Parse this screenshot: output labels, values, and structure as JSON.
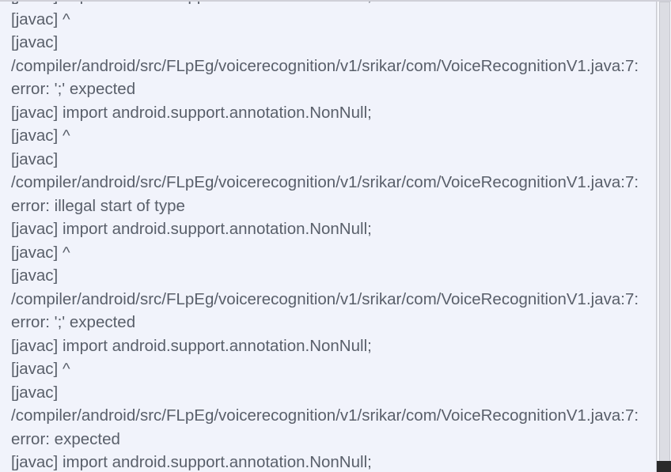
{
  "console": {
    "lines": [
      "[javac] import android.support.annotation.NonNull;",
      "[javac] ^",
      "[javac]",
      "/compiler/android/src/FLpEg/voicerecognition/v1/srikar/com/VoiceRecognitionV1.java:7:",
      "error: ';' expected",
      "[javac] import android.support.annotation.NonNull;",
      "[javac] ^",
      "[javac]",
      "/compiler/android/src/FLpEg/voicerecognition/v1/srikar/com/VoiceRecognitionV1.java:7:",
      "error: illegal start of type",
      "[javac] import android.support.annotation.NonNull;",
      "[javac] ^",
      "[javac]",
      "/compiler/android/src/FLpEg/voicerecognition/v1/srikar/com/VoiceRecognitionV1.java:7:",
      "error: ';' expected",
      "[javac] import android.support.annotation.NonNull;",
      "[javac] ^",
      "[javac]",
      "/compiler/android/src/FLpEg/voicerecognition/v1/srikar/com/VoiceRecognitionV1.java:7:",
      "error: expected",
      "[javac] import android.support.annotation.NonNull;"
    ]
  }
}
